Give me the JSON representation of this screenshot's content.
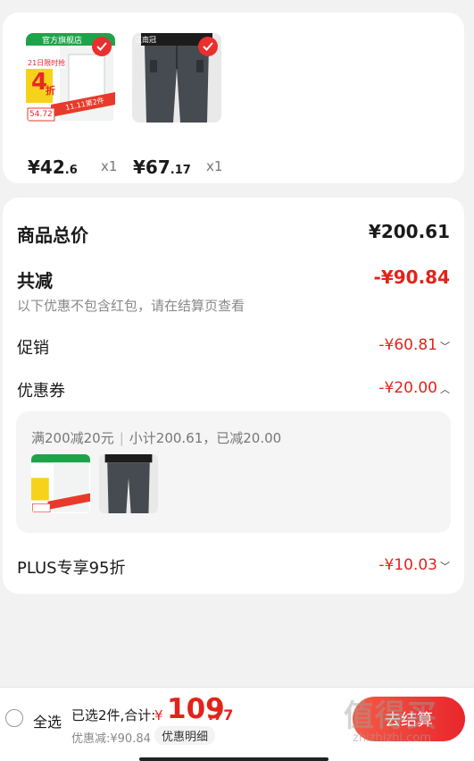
{
  "products": [
    {
      "price_int": "¥42",
      "price_dec": ".6",
      "qty": "x1",
      "store_tag": "官方旗舰店",
      "promo_tag": "21日限时抢",
      "promo_big": "4",
      "promo_unit": "折",
      "side_promo": "11.11第2件",
      "old_price": "54.72"
    },
    {
      "price_int": "¥67",
      "price_dec": ".17",
      "qty": "x1",
      "store_tag": "江南冠"
    }
  ],
  "summary": {
    "total_label": "商品总价",
    "total_value": "¥200.61",
    "reduce_label": "共减",
    "reduce_value": "-¥90.84",
    "note": "以下优惠不包含红包，请在结算页查看",
    "promo_label": "促销",
    "promo_value": "-¥60.81",
    "coupon_label": "优惠券",
    "coupon_value": "-¥20.00",
    "coupon_rule": "满200减20元",
    "coupon_detail": "小计200.61，已减20.00",
    "plus_label": "PLUS专享95折",
    "plus_value": "-¥10.03"
  },
  "bottom": {
    "select_all": "全选",
    "selected_text": "已选2件,合计:",
    "currency": "¥",
    "total_int": "109",
    "total_dec": ".77",
    "discount_text": "优惠减:¥90.84",
    "detail_btn": "优惠明细",
    "checkout": "去结算",
    "watermark": "值得买",
    "watermark_url": "zhizhizhi.com"
  },
  "colors": {
    "accent": "#e2231a",
    "check": "#ea2f2f"
  },
  "icons": {
    "check": "check-icon",
    "chevron_down": "chevron-down-icon",
    "chevron_up": "chevron-up-icon",
    "radio": "radio-unchecked-icon"
  }
}
